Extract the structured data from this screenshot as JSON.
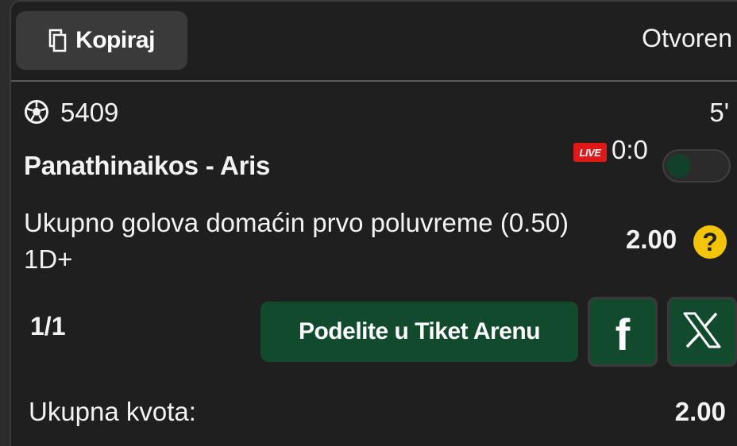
{
  "header": {
    "copy_label": "Kopiraj",
    "status": "Otvoren"
  },
  "ticket": {
    "id": "5409",
    "minute": "5'",
    "match": "Panathinaikos - Aris",
    "live_badge": "LIVE",
    "score": "0:0",
    "market": "Ukupno golova domaćin prvo poluvreme (0.50) 1D+",
    "odd": "2.00",
    "help_symbol": "?"
  },
  "footer": {
    "page_count": "1/1",
    "share_label": "Podelite u Tiket Arenu",
    "facebook_symbol": "f",
    "total_label": "Ukupna kvota:",
    "total_value": "2.00"
  },
  "colors": {
    "background": "#1f1f1f",
    "share_green": "#124a2e",
    "live_red": "#e01818",
    "help_yellow": "#f3c400"
  },
  "icons": [
    "copy-icon",
    "soccer-ball-icon",
    "question-icon",
    "facebook-icon",
    "x-logo-icon"
  ]
}
